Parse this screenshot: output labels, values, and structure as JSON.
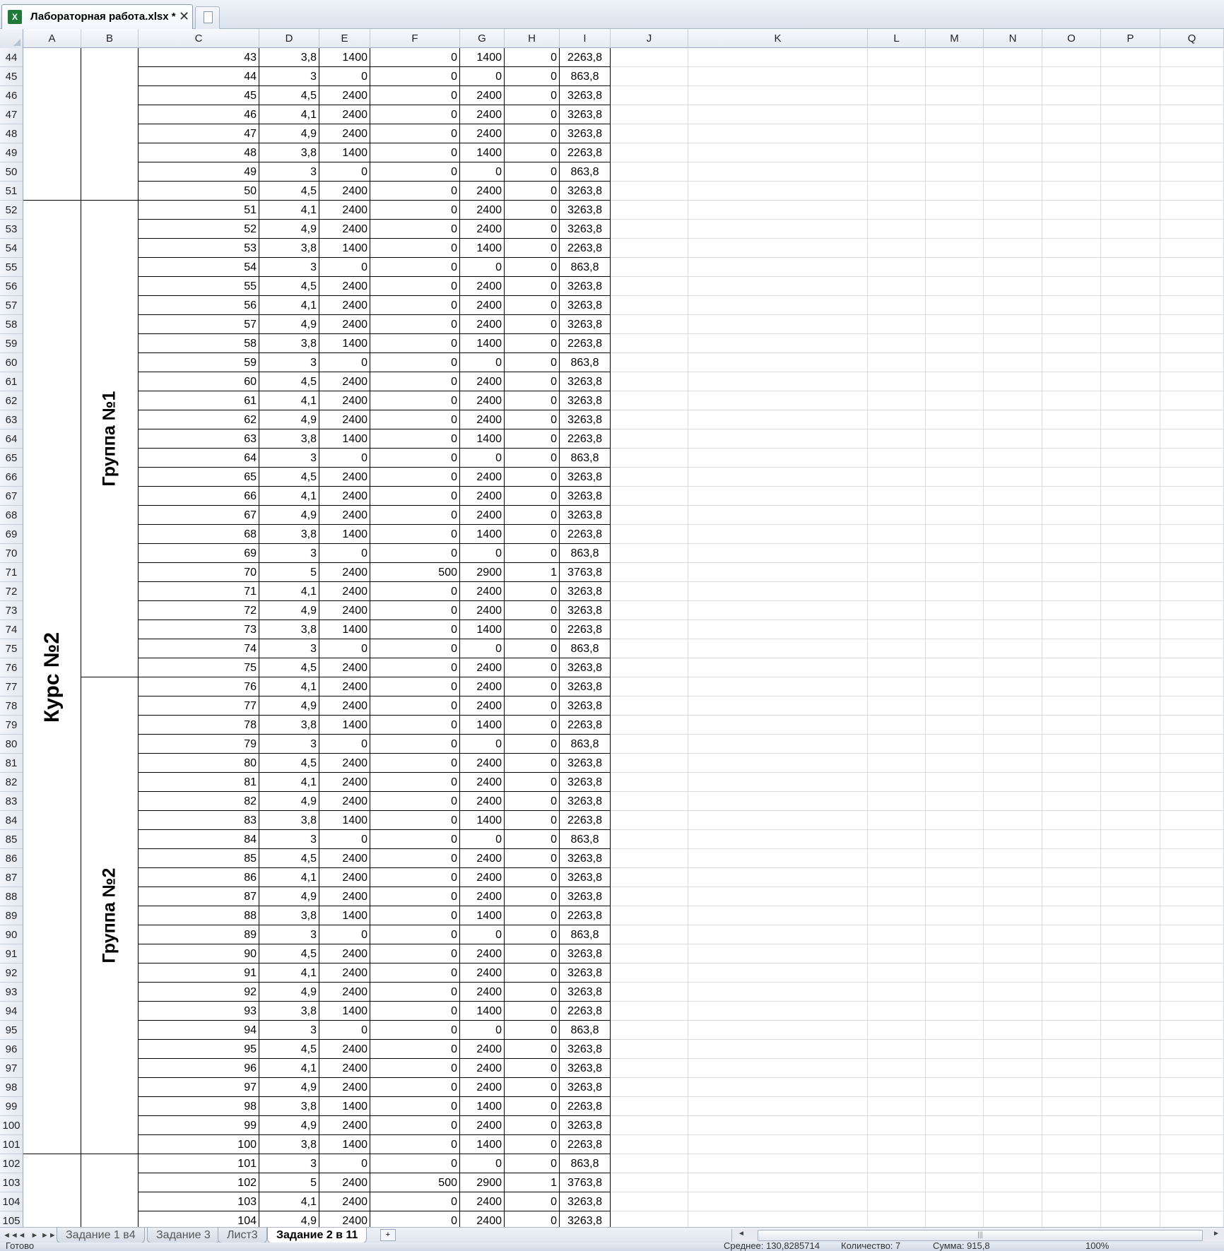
{
  "window": {
    "doc_tab_title": "Лабораторная работа.xlsx *",
    "excel_icon_letter": "X",
    "close_glyph": "✕"
  },
  "columns": [
    "A",
    "B",
    "C",
    "D",
    "E",
    "F",
    "G",
    "H",
    "I",
    "J",
    "K",
    "L",
    "M",
    "N",
    "O",
    "P",
    "Q"
  ],
  "merged_labels": {
    "course": "Курс №2",
    "group1": "Группа №1",
    "group2": "Группа №2"
  },
  "rows": [
    {
      "r": 44,
      "c": 43,
      "d": "3,8",
      "e": 1400,
      "f": 0,
      "g": 1400,
      "h": 0,
      "i": "2263,8"
    },
    {
      "r": 45,
      "c": 44,
      "d": "3",
      "e": 0,
      "f": 0,
      "g": 0,
      "h": 0,
      "i": "863,8"
    },
    {
      "r": 46,
      "c": 45,
      "d": "4,5",
      "e": 2400,
      "f": 0,
      "g": 2400,
      "h": 0,
      "i": "3263,8"
    },
    {
      "r": 47,
      "c": 46,
      "d": "4,1",
      "e": 2400,
      "f": 0,
      "g": 2400,
      "h": 0,
      "i": "3263,8"
    },
    {
      "r": 48,
      "c": 47,
      "d": "4,9",
      "e": 2400,
      "f": 0,
      "g": 2400,
      "h": 0,
      "i": "3263,8"
    },
    {
      "r": 49,
      "c": 48,
      "d": "3,8",
      "e": 1400,
      "f": 0,
      "g": 1400,
      "h": 0,
      "i": "2263,8"
    },
    {
      "r": 50,
      "c": 49,
      "d": "3",
      "e": 0,
      "f": 0,
      "g": 0,
      "h": 0,
      "i": "863,8"
    },
    {
      "r": 51,
      "c": 50,
      "d": "4,5",
      "e": 2400,
      "f": 0,
      "g": 2400,
      "h": 0,
      "i": "3263,8"
    },
    {
      "r": 52,
      "c": 51,
      "d": "4,1",
      "e": 2400,
      "f": 0,
      "g": 2400,
      "h": 0,
      "i": "3263,8"
    },
    {
      "r": 53,
      "c": 52,
      "d": "4,9",
      "e": 2400,
      "f": 0,
      "g": 2400,
      "h": 0,
      "i": "3263,8"
    },
    {
      "r": 54,
      "c": 53,
      "d": "3,8",
      "e": 1400,
      "f": 0,
      "g": 1400,
      "h": 0,
      "i": "2263,8"
    },
    {
      "r": 55,
      "c": 54,
      "d": "3",
      "e": 0,
      "f": 0,
      "g": 0,
      "h": 0,
      "i": "863,8"
    },
    {
      "r": 56,
      "c": 55,
      "d": "4,5",
      "e": 2400,
      "f": 0,
      "g": 2400,
      "h": 0,
      "i": "3263,8"
    },
    {
      "r": 57,
      "c": 56,
      "d": "4,1",
      "e": 2400,
      "f": 0,
      "g": 2400,
      "h": 0,
      "i": "3263,8"
    },
    {
      "r": 58,
      "c": 57,
      "d": "4,9",
      "e": 2400,
      "f": 0,
      "g": 2400,
      "h": 0,
      "i": "3263,8"
    },
    {
      "r": 59,
      "c": 58,
      "d": "3,8",
      "e": 1400,
      "f": 0,
      "g": 1400,
      "h": 0,
      "i": "2263,8"
    },
    {
      "r": 60,
      "c": 59,
      "d": "3",
      "e": 0,
      "f": 0,
      "g": 0,
      "h": 0,
      "i": "863,8"
    },
    {
      "r": 61,
      "c": 60,
      "d": "4,5",
      "e": 2400,
      "f": 0,
      "g": 2400,
      "h": 0,
      "i": "3263,8"
    },
    {
      "r": 62,
      "c": 61,
      "d": "4,1",
      "e": 2400,
      "f": 0,
      "g": 2400,
      "h": 0,
      "i": "3263,8"
    },
    {
      "r": 63,
      "c": 62,
      "d": "4,9",
      "e": 2400,
      "f": 0,
      "g": 2400,
      "h": 0,
      "i": "3263,8"
    },
    {
      "r": 64,
      "c": 63,
      "d": "3,8",
      "e": 1400,
      "f": 0,
      "g": 1400,
      "h": 0,
      "i": "2263,8"
    },
    {
      "r": 65,
      "c": 64,
      "d": "3",
      "e": 0,
      "f": 0,
      "g": 0,
      "h": 0,
      "i": "863,8"
    },
    {
      "r": 66,
      "c": 65,
      "d": "4,5",
      "e": 2400,
      "f": 0,
      "g": 2400,
      "h": 0,
      "i": "3263,8"
    },
    {
      "r": 67,
      "c": 66,
      "d": "4,1",
      "e": 2400,
      "f": 0,
      "g": 2400,
      "h": 0,
      "i": "3263,8"
    },
    {
      "r": 68,
      "c": 67,
      "d": "4,9",
      "e": 2400,
      "f": 0,
      "g": 2400,
      "h": 0,
      "i": "3263,8"
    },
    {
      "r": 69,
      "c": 68,
      "d": "3,8",
      "e": 1400,
      "f": 0,
      "g": 1400,
      "h": 0,
      "i": "2263,8"
    },
    {
      "r": 70,
      "c": 69,
      "d": "3",
      "e": 0,
      "f": 0,
      "g": 0,
      "h": 0,
      "i": "863,8"
    },
    {
      "r": 71,
      "c": 70,
      "d": "5",
      "e": 2400,
      "f": 500,
      "g": 2900,
      "h": 1,
      "i": "3763,8"
    },
    {
      "r": 72,
      "c": 71,
      "d": "4,1",
      "e": 2400,
      "f": 0,
      "g": 2400,
      "h": 0,
      "i": "3263,8"
    },
    {
      "r": 73,
      "c": 72,
      "d": "4,9",
      "e": 2400,
      "f": 0,
      "g": 2400,
      "h": 0,
      "i": "3263,8"
    },
    {
      "r": 74,
      "c": 73,
      "d": "3,8",
      "e": 1400,
      "f": 0,
      "g": 1400,
      "h": 0,
      "i": "2263,8"
    },
    {
      "r": 75,
      "c": 74,
      "d": "3",
      "e": 0,
      "f": 0,
      "g": 0,
      "h": 0,
      "i": "863,8"
    },
    {
      "r": 76,
      "c": 75,
      "d": "4,5",
      "e": 2400,
      "f": 0,
      "g": 2400,
      "h": 0,
      "i": "3263,8"
    },
    {
      "r": 77,
      "c": 76,
      "d": "4,1",
      "e": 2400,
      "f": 0,
      "g": 2400,
      "h": 0,
      "i": "3263,8"
    },
    {
      "r": 78,
      "c": 77,
      "d": "4,9",
      "e": 2400,
      "f": 0,
      "g": 2400,
      "h": 0,
      "i": "3263,8"
    },
    {
      "r": 79,
      "c": 78,
      "d": "3,8",
      "e": 1400,
      "f": 0,
      "g": 1400,
      "h": 0,
      "i": "2263,8"
    },
    {
      "r": 80,
      "c": 79,
      "d": "3",
      "e": 0,
      "f": 0,
      "g": 0,
      "h": 0,
      "i": "863,8"
    },
    {
      "r": 81,
      "c": 80,
      "d": "4,5",
      "e": 2400,
      "f": 0,
      "g": 2400,
      "h": 0,
      "i": "3263,8"
    },
    {
      "r": 82,
      "c": 81,
      "d": "4,1",
      "e": 2400,
      "f": 0,
      "g": 2400,
      "h": 0,
      "i": "3263,8"
    },
    {
      "r": 83,
      "c": 82,
      "d": "4,9",
      "e": 2400,
      "f": 0,
      "g": 2400,
      "h": 0,
      "i": "3263,8"
    },
    {
      "r": 84,
      "c": 83,
      "d": "3,8",
      "e": 1400,
      "f": 0,
      "g": 1400,
      "h": 0,
      "i": "2263,8"
    },
    {
      "r": 85,
      "c": 84,
      "d": "3",
      "e": 0,
      "f": 0,
      "g": 0,
      "h": 0,
      "i": "863,8"
    },
    {
      "r": 86,
      "c": 85,
      "d": "4,5",
      "e": 2400,
      "f": 0,
      "g": 2400,
      "h": 0,
      "i": "3263,8"
    },
    {
      "r": 87,
      "c": 86,
      "d": "4,1",
      "e": 2400,
      "f": 0,
      "g": 2400,
      "h": 0,
      "i": "3263,8"
    },
    {
      "r": 88,
      "c": 87,
      "d": "4,9",
      "e": 2400,
      "f": 0,
      "g": 2400,
      "h": 0,
      "i": "3263,8"
    },
    {
      "r": 89,
      "c": 88,
      "d": "3,8",
      "e": 1400,
      "f": 0,
      "g": 1400,
      "h": 0,
      "i": "2263,8"
    },
    {
      "r": 90,
      "c": 89,
      "d": "3",
      "e": 0,
      "f": 0,
      "g": 0,
      "h": 0,
      "i": "863,8"
    },
    {
      "r": 91,
      "c": 90,
      "d": "4,5",
      "e": 2400,
      "f": 0,
      "g": 2400,
      "h": 0,
      "i": "3263,8"
    },
    {
      "r": 92,
      "c": 91,
      "d": "4,1",
      "e": 2400,
      "f": 0,
      "g": 2400,
      "h": 0,
      "i": "3263,8"
    },
    {
      "r": 93,
      "c": 92,
      "d": "4,9",
      "e": 2400,
      "f": 0,
      "g": 2400,
      "h": 0,
      "i": "3263,8"
    },
    {
      "r": 94,
      "c": 93,
      "d": "3,8",
      "e": 1400,
      "f": 0,
      "g": 1400,
      "h": 0,
      "i": "2263,8"
    },
    {
      "r": 95,
      "c": 94,
      "d": "3",
      "e": 0,
      "f": 0,
      "g": 0,
      "h": 0,
      "i": "863,8"
    },
    {
      "r": 96,
      "c": 95,
      "d": "4,5",
      "e": 2400,
      "f": 0,
      "g": 2400,
      "h": 0,
      "i": "3263,8"
    },
    {
      "r": 97,
      "c": 96,
      "d": "4,1",
      "e": 2400,
      "f": 0,
      "g": 2400,
      "h": 0,
      "i": "3263,8"
    },
    {
      "r": 98,
      "c": 97,
      "d": "4,9",
      "e": 2400,
      "f": 0,
      "g": 2400,
      "h": 0,
      "i": "3263,8"
    },
    {
      "r": 99,
      "c": 98,
      "d": "3,8",
      "e": 1400,
      "f": 0,
      "g": 1400,
      "h": 0,
      "i": "2263,8"
    },
    {
      "r": 100,
      "c": 99,
      "d": "4,9",
      "e": 2400,
      "f": 0,
      "g": 2400,
      "h": 0,
      "i": "3263,8"
    },
    {
      "r": 101,
      "c": 100,
      "d": "3,8",
      "e": 1400,
      "f": 0,
      "g": 1400,
      "h": 0,
      "i": "2263,8"
    },
    {
      "r": 102,
      "c": 101,
      "d": "3",
      "e": 0,
      "f": 0,
      "g": 0,
      "h": 0,
      "i": "863,8"
    },
    {
      "r": 103,
      "c": 102,
      "d": "5",
      "e": 2400,
      "f": 500,
      "g": 2900,
      "h": 1,
      "i": "3763,8"
    },
    {
      "r": 104,
      "c": 103,
      "d": "4,1",
      "e": 2400,
      "f": 0,
      "g": 2400,
      "h": 0,
      "i": "3263,8"
    },
    {
      "r": 105,
      "c": 104,
      "d": "4,9",
      "e": 2400,
      "f": 0,
      "g": 2400,
      "h": 0,
      "i": "3263,8"
    }
  ],
  "sheet_tabs": [
    {
      "label": "Задание 1 в4",
      "active": false
    },
    {
      "label": "Задание 3",
      "active": false
    },
    {
      "label": "Лист3",
      "active": false
    },
    {
      "label": "Задание 2 в 11",
      "active": true
    }
  ],
  "sheet_nav": {
    "first": "◄◄",
    "prev": "◄",
    "next": "►",
    "last": "►►"
  },
  "status_bar": {
    "ready": "Готово",
    "average": "Среднее: 130,8285714",
    "count": "Количество: 7",
    "sum": "Сумма: 915,8",
    "zoom": "100%"
  }
}
